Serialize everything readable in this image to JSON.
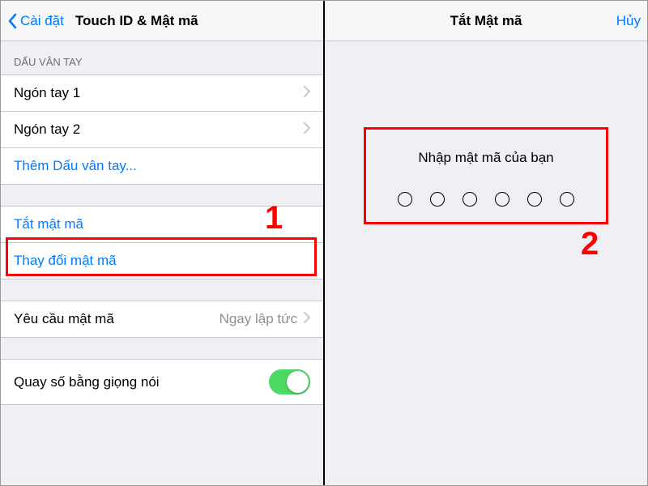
{
  "left": {
    "nav": {
      "back": "Cài đặt",
      "title": "Touch ID & Mật mã"
    },
    "section_fingerprints": "DẤU VÂN TAY",
    "finger1": "Ngón tay 1",
    "finger2": "Ngón tay 2",
    "add_fingerprint": "Thêm Dấu vân tay...",
    "turn_off_passcode": "Tắt mật mã",
    "change_passcode": "Thay đổi mật mã",
    "require_passcode": {
      "label": "Yêu cầu mật mã",
      "value": "Ngay lập tức"
    },
    "voice_dial": "Quay số bằng giọng nói"
  },
  "right": {
    "nav": {
      "title": "Tắt Mật mã",
      "cancel": "Hủy"
    },
    "prompt": "Nhập mật mã của bạn"
  },
  "annotations": {
    "num1": "1",
    "num2": "2"
  }
}
